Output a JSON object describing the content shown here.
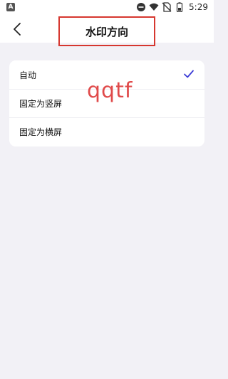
{
  "status_bar": {
    "left_icon": "A",
    "time": "5:29",
    "icons": [
      "dnd-icon",
      "wifi-icon",
      "no-sim-icon",
      "battery-icon"
    ]
  },
  "header": {
    "title": "水印方向",
    "back_icon": "chevron-left-icon"
  },
  "options": [
    {
      "label": "自动",
      "selected": true
    },
    {
      "label": "固定为竖屏",
      "selected": false
    },
    {
      "label": "固定为横屏",
      "selected": false
    }
  ],
  "watermark_text": "qqtf",
  "colors": {
    "accent": "#3b3bd6",
    "highlight_border": "#d6372f",
    "watermark": "#e04a4a",
    "background": "#f2f1f6"
  }
}
